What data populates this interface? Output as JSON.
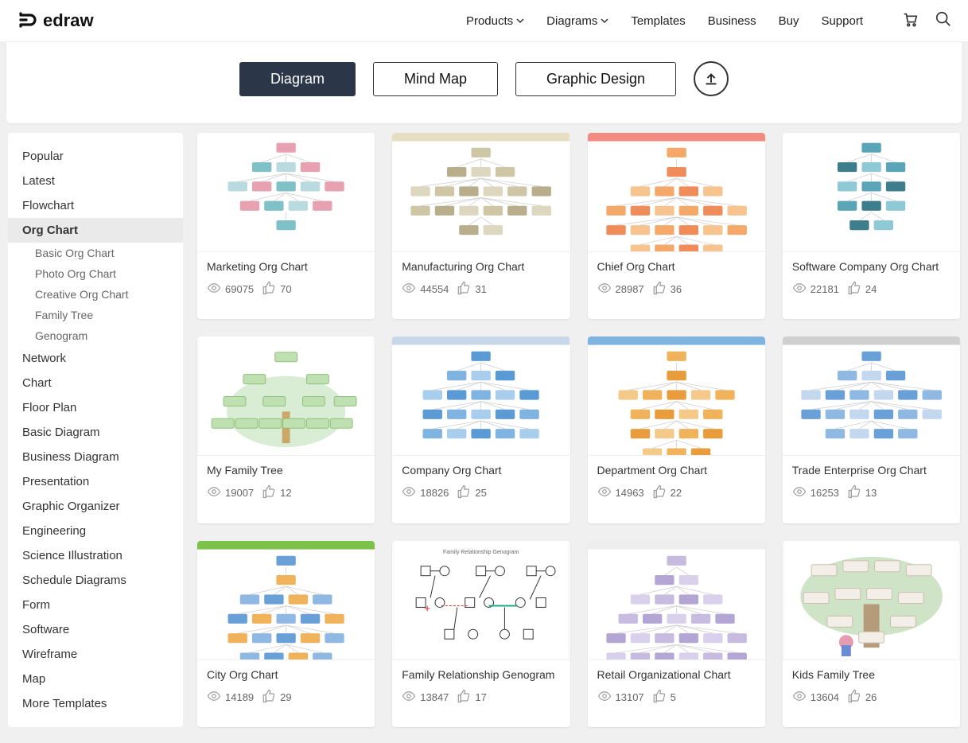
{
  "brand": "edraw",
  "nav": {
    "products": "Products",
    "diagrams": "Diagrams",
    "templates": "Templates",
    "business": "Business",
    "buy": "Buy",
    "support": "Support"
  },
  "tabs": {
    "diagram": "Diagram",
    "mindmap": "Mind Map",
    "graphic": "Graphic Design"
  },
  "sidebar": {
    "categories": [
      "Popular",
      "Latest",
      "Flowchart",
      "Org Chart",
      "Network",
      "Chart",
      "Floor Plan",
      "Basic Diagram",
      "Business Diagram",
      "Presentation",
      "Graphic Organizer",
      "Engineering",
      "Science Illustration",
      "Schedule Diagrams",
      "Form",
      "Software",
      "Wireframe",
      "Map",
      "More Templates"
    ],
    "active_index": 3,
    "subcategories": [
      "Basic Org Chart",
      "Photo Org Chart",
      "Creative Org Chart",
      "Family Tree",
      "Genogram"
    ]
  },
  "templates": [
    {
      "title": "Marketing Org Chart",
      "views": "69075",
      "likes": "70"
    },
    {
      "title": "Manufacturing Org Chart",
      "views": "44554",
      "likes": "31"
    },
    {
      "title": "Chief Org Chart",
      "views": "28987",
      "likes": "36"
    },
    {
      "title": "Software Company Org Chart",
      "views": "22181",
      "likes": "24"
    },
    {
      "title": "My Family Tree",
      "views": "19007",
      "likes": "12"
    },
    {
      "title": "Company Org Chart",
      "views": "18826",
      "likes": "25"
    },
    {
      "title": "Department Org Chart",
      "views": "14963",
      "likes": "22"
    },
    {
      "title": "Trade Enterprise Org Chart",
      "views": "16253",
      "likes": "13"
    },
    {
      "title": "City Org Chart",
      "views": "14189",
      "likes": "29"
    },
    {
      "title": "Family Relationship Genogram",
      "views": "13847",
      "likes": "17"
    },
    {
      "title": "Retail Organizational Chart",
      "views": "13107",
      "likes": "5"
    },
    {
      "title": "Kids Family Tree",
      "views": "13604",
      "likes": "26"
    }
  ]
}
